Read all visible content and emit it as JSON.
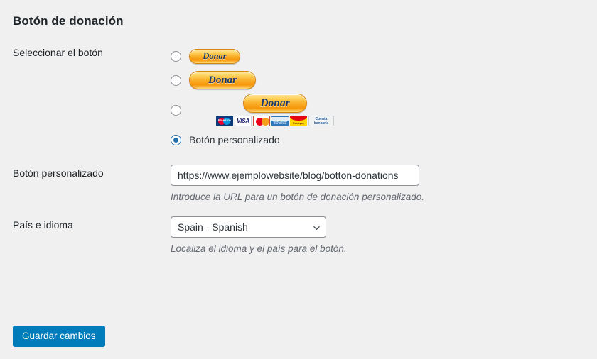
{
  "page": {
    "title": "Botón de donación",
    "background_color": "#f0f0f1"
  },
  "fields": {
    "select_button": {
      "label": "Seleccionar el botón",
      "options": [
        {
          "id": "small",
          "type": "paypal-donate-small",
          "button_label": "Donar",
          "selected": false,
          "has_cards": false
        },
        {
          "id": "medium",
          "type": "paypal-donate-medium",
          "button_label": "Donar",
          "selected": false,
          "has_cards": false
        },
        {
          "id": "large-cards",
          "type": "paypal-donate-large-with-cards",
          "button_label": "Donar",
          "selected": false,
          "has_cards": true,
          "cards": [
            {
              "name": "maestro-card-icon",
              "label": "Maestro"
            },
            {
              "name": "visa-card-icon",
              "label": "VISA"
            },
            {
              "name": "mastercard-card-icon",
              "label": ""
            },
            {
              "name": "amex-card-icon",
              "label": "AMERICAN EXPRESS"
            },
            {
              "name": "postepay-card-icon",
              "label": "Postepay"
            },
            {
              "name": "bank-account-icon",
              "label_line1": "Cuenta",
              "label_line2": "bancaria"
            }
          ]
        },
        {
          "id": "custom",
          "type": "custom",
          "button_label": "Botón personalizado",
          "selected": true,
          "has_cards": false
        }
      ]
    },
    "custom_button": {
      "label": "Botón personalizado",
      "value": "https://www.ejemplowebsite/blog/botton-donations",
      "placeholder": "",
      "description": "Introduce la URL para un botón de donación personalizado."
    },
    "country_language": {
      "label": "País e idioma",
      "selected": "Spain - Spanish",
      "description": "Localiza el idioma y el país para el botón.",
      "chevron_icon": "chevron-down-icon"
    }
  },
  "submit": {
    "label": "Guardar cambios",
    "color": "#007cba"
  }
}
